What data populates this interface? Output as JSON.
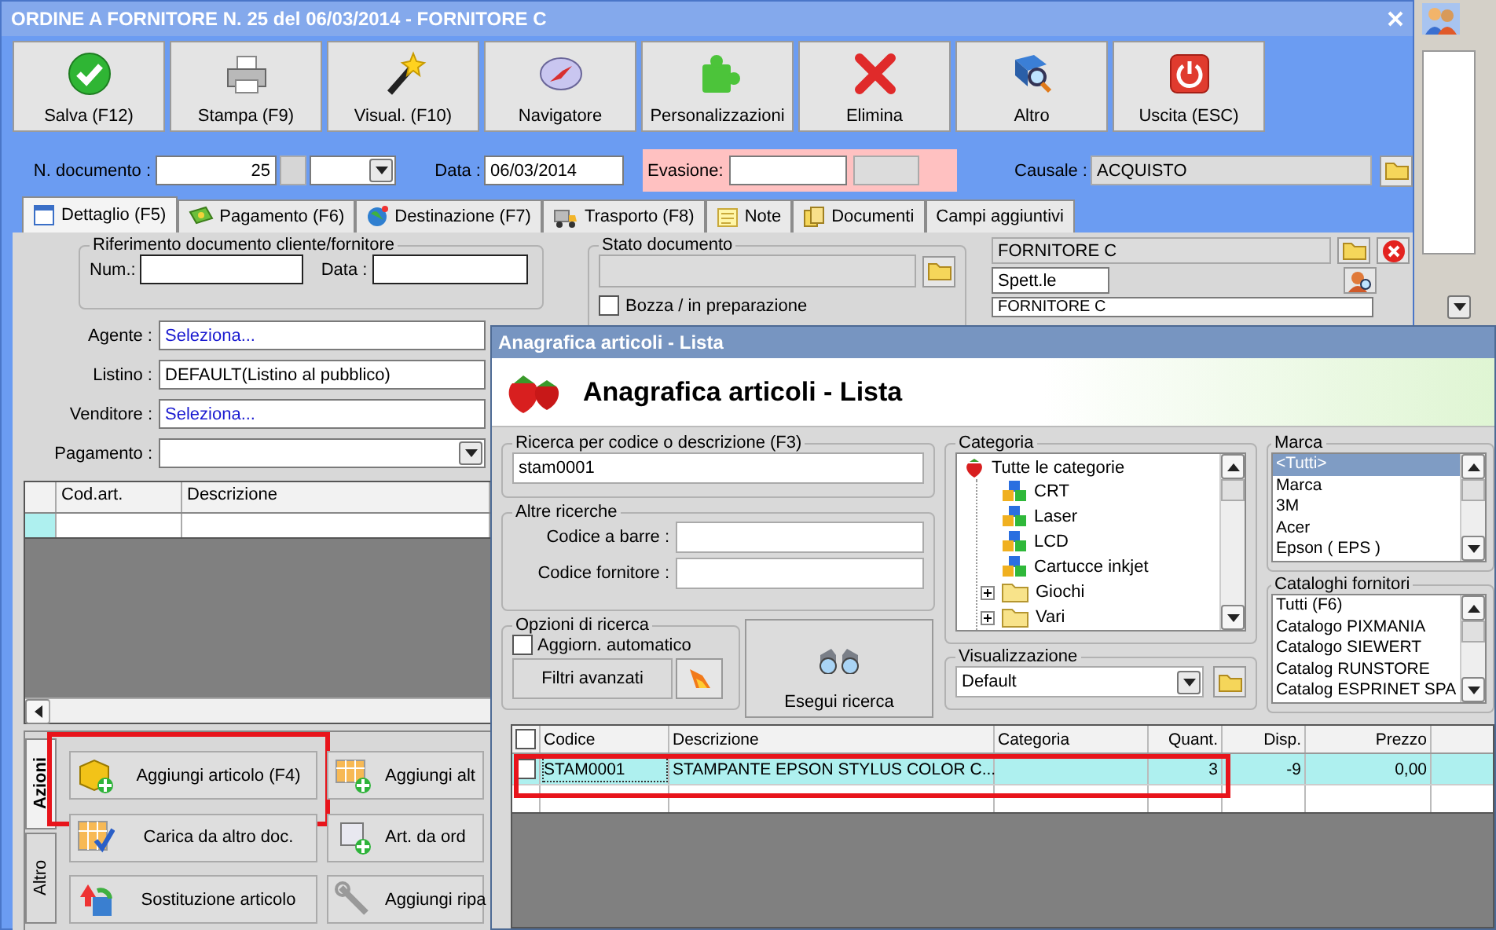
{
  "window": {
    "title": "ORDINE A FORNITORE N. 25 del 06/03/2014 - FORNITORE C"
  },
  "toolbar": [
    {
      "label": "Salva (F12)",
      "kind": "save"
    },
    {
      "label": "Stampa (F9)",
      "kind": "print"
    },
    {
      "label": "Visual. (F10)",
      "kind": "preview"
    },
    {
      "label": "Navigatore",
      "kind": "navigator"
    },
    {
      "label": "Personalizzazioni",
      "kind": "customize"
    },
    {
      "label": "Elimina",
      "kind": "delete"
    },
    {
      "label": "Altro",
      "kind": "more"
    },
    {
      "label": "Uscita (ESC)",
      "kind": "exit"
    }
  ],
  "header": {
    "number_label": "N. documento :",
    "number": "25",
    "date_label": "Data :",
    "date": "06/03/2014",
    "evasione_label": "Evasione:",
    "causale_label": "Causale :",
    "causale": "ACQUISTO"
  },
  "tabs": [
    {
      "label": "Dettaglio (F5)",
      "selected": true
    },
    {
      "label": "Pagamento (F6)",
      "selected": false
    },
    {
      "label": "Destinazione (F7)",
      "selected": false
    },
    {
      "label": "Trasporto (F8)",
      "selected": false
    },
    {
      "label": "Note",
      "selected": false
    },
    {
      "label": "Documenti",
      "selected": false
    },
    {
      "label": "Campi aggiuntivi",
      "selected": false
    }
  ],
  "reference": {
    "legend": "Riferimento documento cliente/fornitore",
    "num_label": "Num.:",
    "date_label": "Data :"
  },
  "fields": [
    {
      "label": "Agente :",
      "value": "Seleziona...",
      "kind": "link"
    },
    {
      "label": "Listino :",
      "value": "DEFAULT(Listino al pubblico)",
      "kind": "text"
    },
    {
      "label": "Venditore :",
      "value": "Seleziona...",
      "kind": "link"
    },
    {
      "label": "Pagamento :",
      "kind": "dropdown"
    }
  ],
  "status": {
    "legend": "Stato documento",
    "draft_label": "Bozza / in preparazione",
    "draft_checked": false
  },
  "supplier": {
    "name": "FORNITORE C",
    "salutation": "Spett.le",
    "address_name": "FORNITORE C"
  },
  "lines_table": {
    "columns": [
      "Cod.art.",
      "Descrizione"
    ]
  },
  "side_tabs": [
    {
      "label": "Azioni",
      "selected": true
    },
    {
      "label": "Altro",
      "selected": false
    }
  ],
  "actions": [
    {
      "label": "Aggiungi articolo (F4)",
      "kind": "add",
      "highlighted": true
    },
    {
      "label": "Aggiungi alt",
      "kind": "add_grid",
      "highlighted": false
    },
    {
      "label": "Carica da altro doc.",
      "kind": "load",
      "highlighted": false
    },
    {
      "label": "Art. da ord",
      "kind": "order",
      "highlighted": false
    },
    {
      "label": "Sostituzione articolo",
      "kind": "replace",
      "highlighted": false
    },
    {
      "label": "Aggiungi ripa",
      "kind": "repair",
      "highlighted": false
    }
  ],
  "dialog": {
    "title": "Anagrafica articoli  - Lista",
    "heading": "Anagrafica articoli  - Lista",
    "search": {
      "legend": "Ricerca per codice o descrizione (F3)",
      "value": "stam0001"
    },
    "other": {
      "legend": "Altre ricerche",
      "barcode_label": "Codice a barre :",
      "supplier_code_label": "Codice fornitore :"
    },
    "options": {
      "legend": "Opzioni di ricerca",
      "auto_label": "Aggiorn. automatico",
      "auto_checked": false,
      "filters": "Filtri avanzati"
    },
    "run": "Esegui ricerca",
    "category": {
      "legend": "Categoria",
      "tree": [
        {
          "label": "Tutte le categorie",
          "kind": "root",
          "children": [
            {
              "label": "CRT",
              "kind": "leaf"
            },
            {
              "label": "Laser",
              "kind": "leaf"
            },
            {
              "label": "LCD",
              "kind": "leaf"
            },
            {
              "label": "Cartucce inkjet",
              "kind": "leaf"
            },
            {
              "label": "Giochi",
              "kind": "folder"
            },
            {
              "label": "Vari",
              "kind": "folder"
            }
          ]
        }
      ]
    },
    "view": {
      "legend": "Visualizzazione",
      "value": "Default"
    },
    "brand": {
      "legend": "Marca",
      "items": [
        {
          "label": "<Tutti>",
          "selected": true
        },
        {
          "label": "Marca",
          "selected": false
        },
        {
          "label": "3M",
          "selected": false
        },
        {
          "label": "Acer",
          "selected": false
        },
        {
          "label": "Epson ( EPS )",
          "selected": false
        }
      ]
    },
    "catalogs": {
      "legend": "Cataloghi fornitori",
      "items": [
        {
          "label": "Tutti (F6)",
          "selected": false
        },
        {
          "label": "Catalogo PIXMANIA",
          "selected": false
        },
        {
          "label": "Catalogo SIEWERT",
          "selected": false
        },
        {
          "label": "Catalog RUNSTORE",
          "selected": false
        },
        {
          "label": "Catalog ESPRINET SPA",
          "selected": false
        }
      ]
    },
    "results": {
      "all_checked": false,
      "columns": [
        "Codice",
        "Descrizione",
        "Categoria",
        "Quant.",
        "Disp.",
        "Prezzo"
      ],
      "rows": [
        {
          "checked": false,
          "highlighted": true,
          "code": "STAM0001",
          "description": "STAMPANTE EPSON STYLUS COLOR C...",
          "quantity": "3",
          "available": "-9",
          "price": "0,00"
        }
      ]
    }
  }
}
